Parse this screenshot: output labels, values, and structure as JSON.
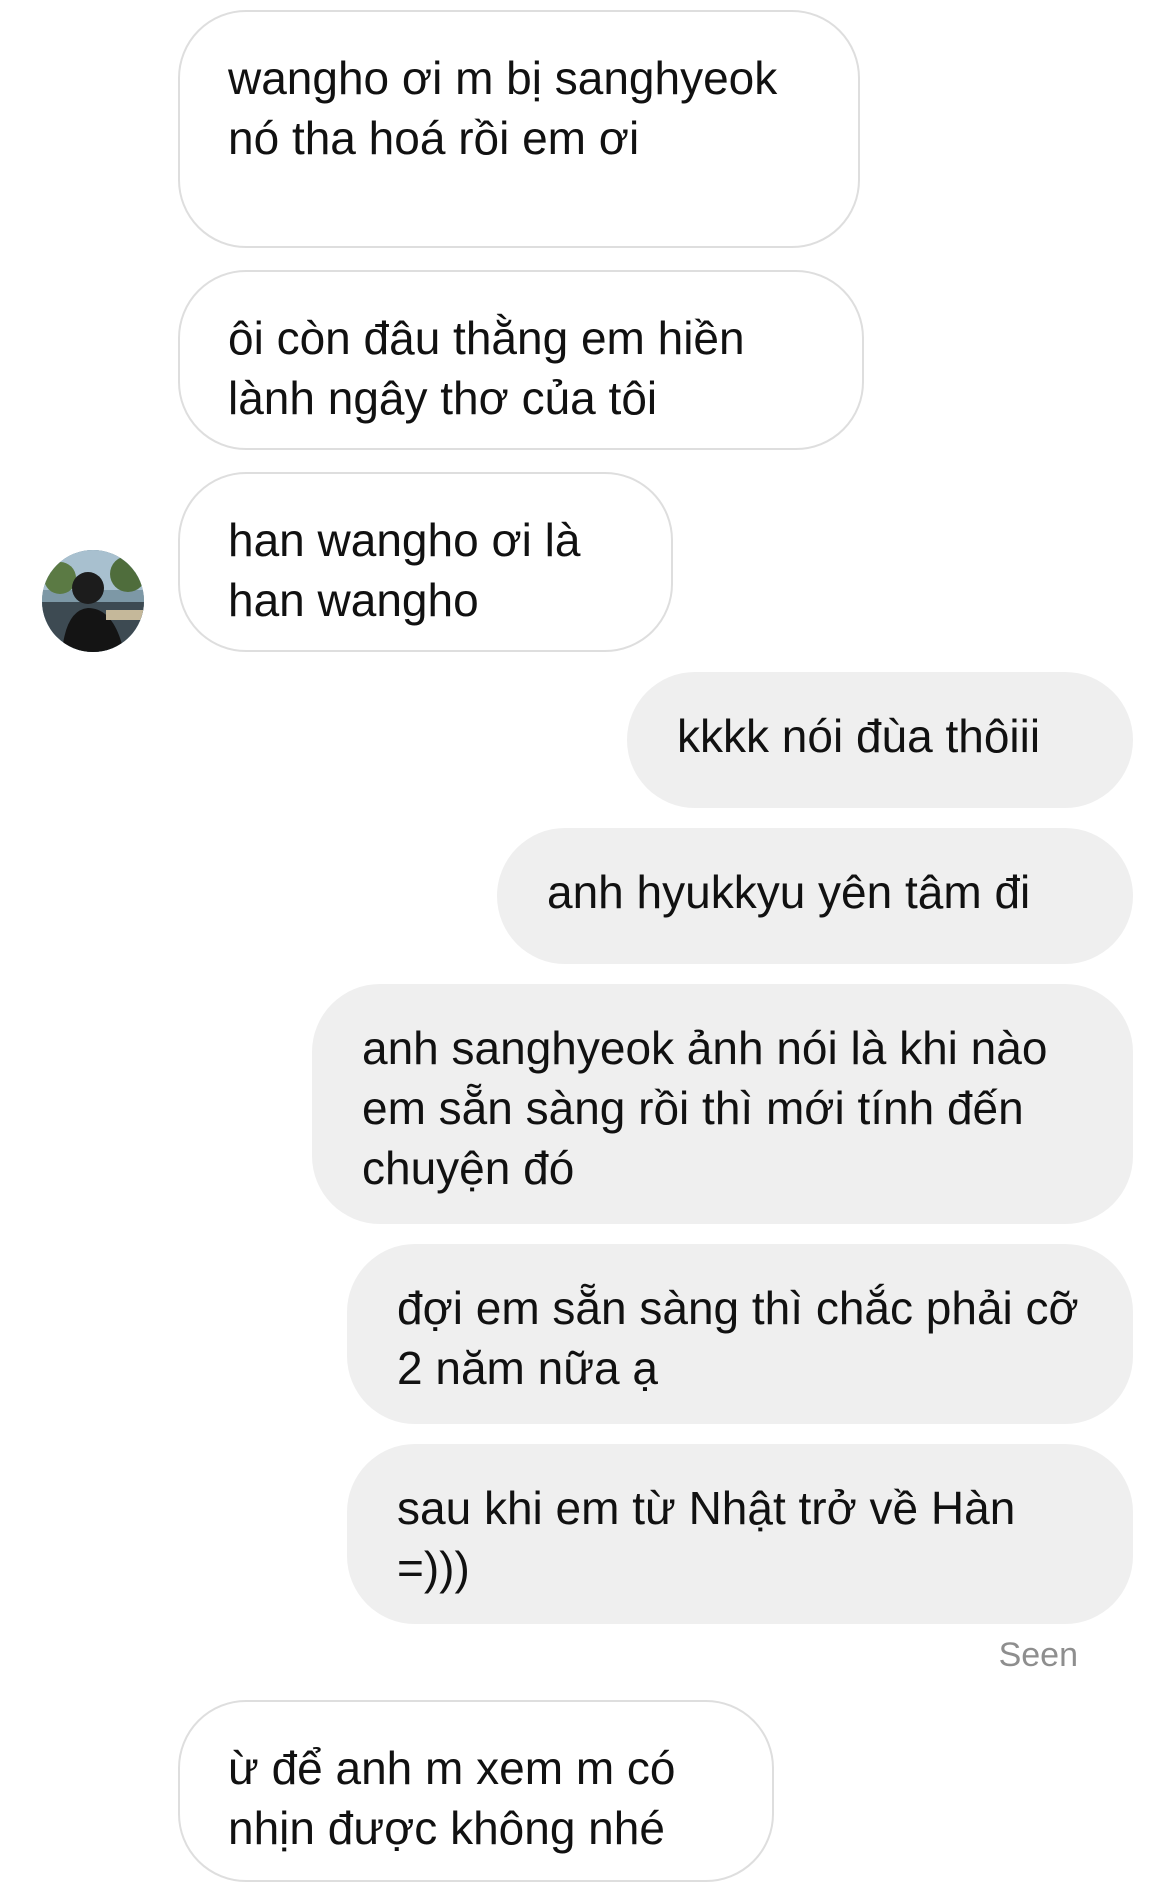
{
  "conversation": {
    "contact_avatar": "profile-photo",
    "seen_label": "Seen",
    "messages": [
      {
        "sender": "them",
        "text": "wangho ơi m bị sanghyeok nó tha hoá rồi em ơi"
      },
      {
        "sender": "them",
        "text": "ôi còn đâu thằng em hiền lành ngây thơ của tôi"
      },
      {
        "sender": "them",
        "text": "han wangho ơi là han wangho"
      },
      {
        "sender": "me",
        "text": "kkkk nói đùa thôiii"
      },
      {
        "sender": "me",
        "text": "anh hyukkyu yên tâm đi"
      },
      {
        "sender": "me",
        "text": "anh sanghyeok ảnh nói là khi nào em sẵn sàng rồi thì mới tính đến chuyện đó"
      },
      {
        "sender": "me",
        "text": "đợi em sẵn sàng thì chắc phải cỡ 2 năm nữa ạ"
      },
      {
        "sender": "me",
        "text": "sau khi em từ Nhật trở về Hàn =)))"
      },
      {
        "sender": "them",
        "text": "ừ để anh m xem m có nhịn được không nhé"
      }
    ]
  },
  "colors": {
    "incoming_bg": "#ffffff",
    "incoming_border": "#dedede",
    "outgoing_bg": "#efefef",
    "seen_text": "#8e8e8e"
  }
}
